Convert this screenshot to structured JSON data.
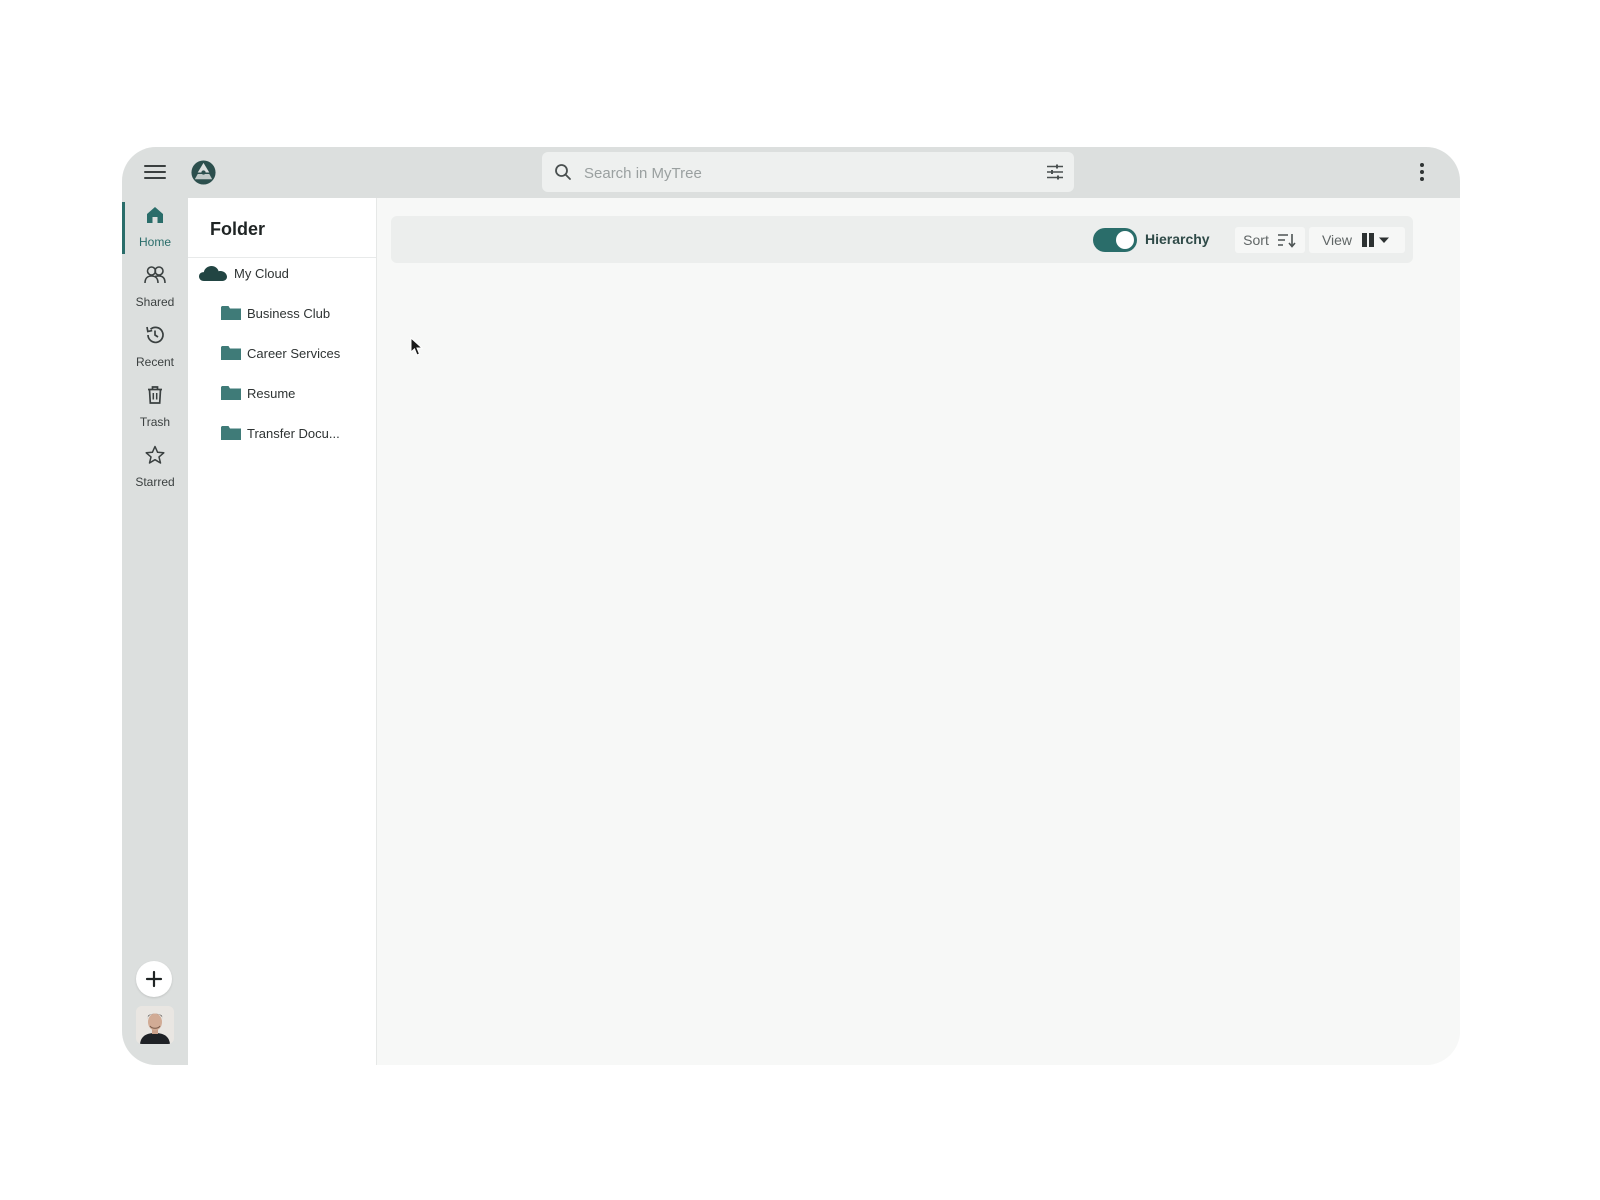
{
  "search": {
    "placeholder": "Search in MyTree"
  },
  "nav": {
    "items": [
      {
        "label": "Home",
        "icon": "home-icon",
        "active": true
      },
      {
        "label": "Shared",
        "icon": "users-icon"
      },
      {
        "label": "Recent",
        "icon": "history-icon"
      },
      {
        "label": "Trash",
        "icon": "trash-icon"
      },
      {
        "label": "Starred",
        "icon": "star-icon"
      }
    ]
  },
  "folder_panel": {
    "title": "Folder",
    "root": {
      "label": "My Cloud",
      "icon": "cloud-icon"
    },
    "folders": [
      {
        "label": "Business Club"
      },
      {
        "label": "Career Services"
      },
      {
        "label": "Resume"
      },
      {
        "label": "Transfer Docu..."
      }
    ]
  },
  "toolbar": {
    "hierarchy_label": "Hierarchy",
    "hierarchy_on": true,
    "sort_label": "Sort",
    "view_label": "View"
  },
  "colors": {
    "accent": "#2a6d6a",
    "folder": "#3f7b78",
    "chrome": "#dcdfde",
    "content_bg": "#f7f8f7"
  }
}
